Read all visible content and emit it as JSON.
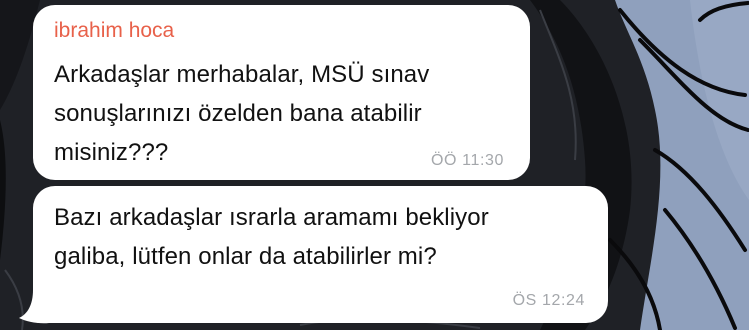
{
  "messages": [
    {
      "sender": "ibrahim hoca",
      "lines": [
        "Arkadaşlar merhabalar, MSÜ sınav",
        "sonuşlarınızı özelden bana atabilir",
        "misiniz???"
      ],
      "time": "ÖÖ 11:30"
    },
    {
      "lines": [
        "Bazı arkadaşlar ısrarla aramamı bekliyor",
        "galiba, lütfen onlar da atabilirler mi?"
      ],
      "time": "ÖS 12:24"
    }
  ],
  "colors": {
    "sender_name": "#e8614a",
    "bubble": "#ffffff",
    "timestamp": "#a4a7ab"
  }
}
